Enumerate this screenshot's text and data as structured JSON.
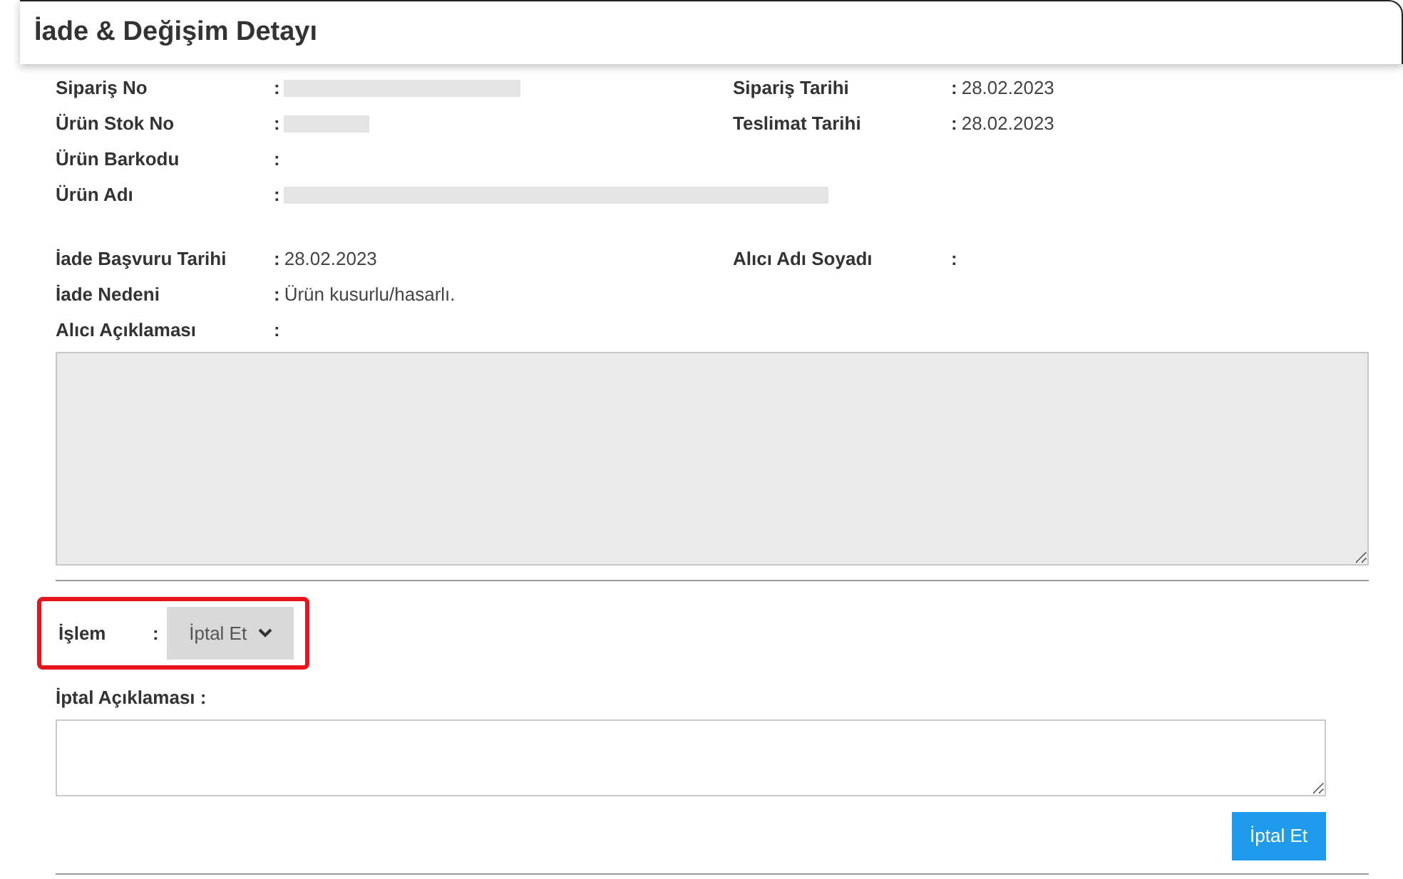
{
  "title": "İade & Değişim Detayı",
  "separator": ":",
  "product_rows": [
    {
      "left": {
        "label": "Sipariş No",
        "kind": "masked"
      },
      "right": {
        "label": "Sipariş Tarihi",
        "kind": "text",
        "value": "28.02.2023"
      }
    },
    {
      "left": {
        "label": "Ürün Stok No",
        "kind": "masked"
      },
      "right": {
        "label": "Teslimat Tarihi",
        "kind": "text",
        "value": "28.02.2023"
      }
    },
    {
      "left": {
        "label": "Ürün Barkodu",
        "kind": "empty"
      }
    },
    {
      "left": {
        "label": "Ürün Adı",
        "kind": "masked"
      }
    }
  ],
  "return_rows": [
    {
      "left": {
        "label": "İade Başvuru Tarihi",
        "kind": "text",
        "value": "28.02.2023"
      },
      "right": {
        "label": "Alıcı Adı Soyadı",
        "kind": "empty"
      }
    },
    {
      "left": {
        "label": "İade Nedeni",
        "kind": "text",
        "value": "Ürün kusurlu/hasarlı."
      }
    },
    {
      "left": {
        "label": "Alıcı Açıklaması",
        "kind": "empty"
      }
    }
  ],
  "action": {
    "label": "İşlem",
    "value": "İptal Et",
    "highlighted": true
  },
  "cancel_note": {
    "label": "İptal Açıklaması :"
  },
  "submit_button": "İptal Et"
}
